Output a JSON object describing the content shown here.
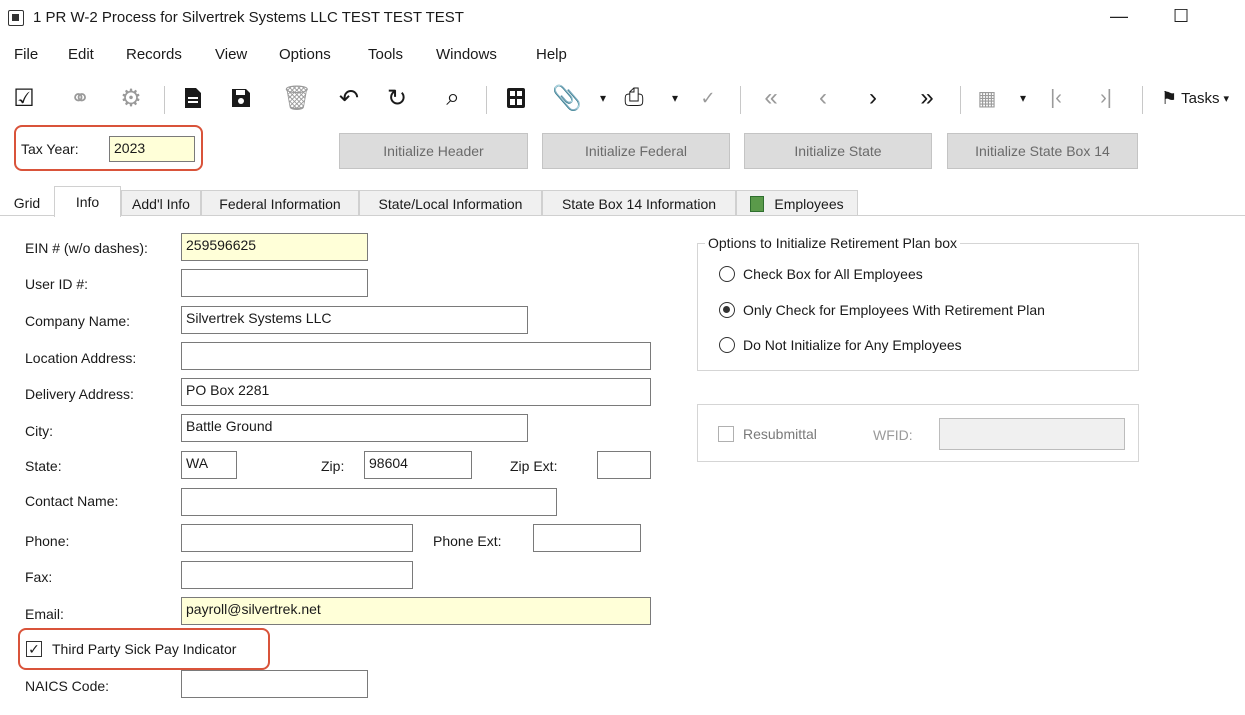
{
  "window": {
    "title": "1 PR W-2 Process for Silvertrek Systems LLC TEST TEST TEST",
    "minimize": "—",
    "maximize": "☐"
  },
  "menu": [
    "File",
    "Edit",
    "Records",
    "View",
    "Options",
    "Tools",
    "Windows",
    "Help"
  ],
  "toolbar": {
    "icons": [
      "select-icon",
      "binoculars-icon",
      "settings-icon",
      "new-document-icon",
      "save-icon",
      "delete-icon",
      "undo-icon",
      "refresh-icon",
      "search-icon",
      "calculator-icon",
      "attach-icon",
      "print-icon",
      "spellcheck-icon",
      "first-record-icon",
      "previous-record-icon",
      "next-record-icon",
      "last-record-icon",
      "grid-settings-icon",
      "go-first-icon",
      "go-last-icon",
      "flag-icon"
    ],
    "tasks_label": "Tasks"
  },
  "header": {
    "tax_year_label": "Tax Year:",
    "tax_year_value": "2023",
    "buttons": [
      "Initialize Header",
      "Initialize Federal",
      "Initialize State",
      "Initialize State Box 14"
    ]
  },
  "tabs": [
    "Grid",
    "Info",
    "Add'l Info",
    "Federal Information",
    "State/Local Information",
    "State Box 14 Information",
    "Employees"
  ],
  "form": {
    "ein_label": "EIN # (w/o dashes):",
    "ein": "259596625",
    "userid_label": "User ID #:",
    "userid": "",
    "company_label": "Company Name:",
    "company": "Silvertrek Systems LLC",
    "location_label": "Location Address:",
    "location": "",
    "delivery_label": "Delivery Address:",
    "delivery": "PO Box 2281",
    "city_label": "City:",
    "city": "Battle Ground",
    "state_label": "State:",
    "state": "WA",
    "zip_label": "Zip:",
    "zip": "98604",
    "zipext_label": "Zip Ext:",
    "zipext": "",
    "contact_label": "Contact Name:",
    "contact": "",
    "phone_label": "Phone:",
    "phone": "",
    "phoneext_label": "Phone Ext:",
    "phoneext": "",
    "fax_label": "Fax:",
    "fax": "",
    "email_label": "Email:",
    "email": "payroll@silvertrek.net",
    "sickpay_label": "Third Party Sick Pay Indicator",
    "sickpay_checked": true,
    "naics_label": "NAICS Code:",
    "naics": ""
  },
  "retirement": {
    "legend": "Options to Initialize Retirement Plan box",
    "options": [
      "Check Box for All Employees",
      "Only Check for Employees With Retirement Plan",
      "Do Not Initialize for Any Employees"
    ],
    "selected_index": 1
  },
  "resubmittal": {
    "label": "Resubmittal",
    "wfid_label": "WFID:",
    "wfid": ""
  },
  "colors": {
    "highlight_border": "#d9533a",
    "required_field": "#ffffd8"
  }
}
